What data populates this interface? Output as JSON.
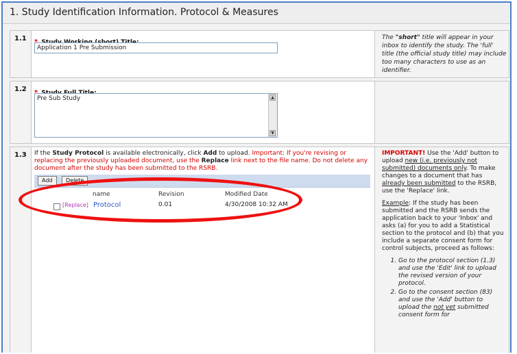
{
  "section": {
    "title": "1. Study Identification Information. Protocol & Measures"
  },
  "row1": {
    "number": "1.1",
    "required_mark": "*",
    "label": "Study Working (short) Title:",
    "value": "Application 1 Pre Submission",
    "help": {
      "p1": "The ",
      "quote_short": "\"short\"",
      "p2": " title will appear in your inbox to identify the study.  The 'full' title (the official study title) may include too many characters to use as an identifier."
    }
  },
  "row2": {
    "number": "1.2",
    "required_mark": "*",
    "label": "Study Full Title:",
    "value": "Pre Sub Study"
  },
  "row3": {
    "number": "1.3",
    "instr": {
      "a": "If the ",
      "b": "Study Protocol",
      "c": " is available electronically, click ",
      "d": "Add",
      "e": " to upload. ",
      "f": "Important: If you're revising or replacing the previously uploaded document, use the ",
      "g": "Replace",
      "h": " link next to the file name.  Do not delete any document after the study has been submitted to the RSRB."
    },
    "buttons": {
      "add": "Add",
      "delete": "Delete"
    },
    "columns": {
      "name": "name",
      "revision": "Revision",
      "modified": "Modified Date"
    },
    "document": {
      "replace_link": "[Replace]",
      "name": "Protocol",
      "revision": "0.01",
      "modified": "4/30/2008 10:32 AM"
    },
    "help": {
      "important": "IMPORTANT!",
      "h1": " Use the 'Add' button to upload ",
      "h1u": "new (i.e. previously not submitted) documents only",
      "h2": ".  To make changes to a document that has ",
      "h2u": "already been submitted",
      "h3": " to the RSRB, use the 'Replace' link.",
      "example_label": "Example",
      "example_text": ": If the study has been submitted and the RSRB sends the application back to your 'Inbox' and asks (a) for you to add a Statistical section to the protocol and (b) that you include a separate consent form for control subjects, proceed as follows:",
      "step1": "Go to the protocol section (1.3) and use the 'Edit' link to upload the revised version of your protocol.",
      "step2a": "Go to the consent section (83) and use the 'Add' button to upload the ",
      "step2u": "not yet",
      "step2b": " submitted consent form for"
    }
  },
  "colors": {
    "accent_border": "#4a7ec4",
    "required": "#dd0000",
    "annotation": "#ee1111",
    "link": "#2a54c8"
  }
}
